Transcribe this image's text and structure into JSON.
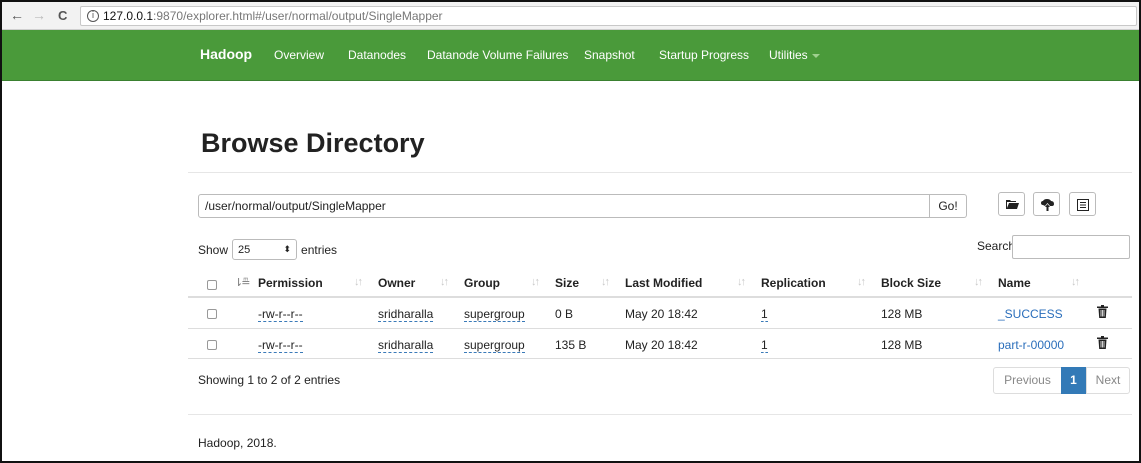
{
  "browser": {
    "host": "127.0.0.1",
    "url_rest": ":9870/explorer.html#/user/normal/output/SingleMapper",
    "back_icon": "←",
    "forward_icon": "→",
    "reload_icon": "C",
    "info_icon": "i"
  },
  "navbar": {
    "brand": "Hadoop",
    "items": [
      "Overview",
      "Datanodes",
      "Datanode Volume Failures",
      "Snapshot",
      "Startup Progress",
      "Utilities"
    ],
    "color": "#4a9a3a"
  },
  "page": {
    "title": "Browse Directory",
    "directory_value": "/user/normal/output/SingleMapper",
    "go_label": "Go!",
    "show_label": "Show",
    "entries_value": "25",
    "entries_label": "entries",
    "search_label": "Search:",
    "showing_text": "Showing 1 to 2 of 2 entries",
    "prev_label": "Previous",
    "page_number": "1",
    "next_label": "Next",
    "footer": "Hadoop, 2018."
  },
  "table": {
    "headers": [
      "Permission",
      "Owner",
      "Group",
      "Size",
      "Last Modified",
      "Replication",
      "Block Size",
      "Name"
    ],
    "rows": [
      [
        "-rw-r--r--",
        "sridharalla",
        "supergroup",
        "0 B",
        "May 20 18:42",
        "1",
        "128 MB",
        "_SUCCESS"
      ],
      [
        "-rw-r--r--",
        "sridharalla",
        "supergroup",
        "135 B",
        "May 20 18:42",
        "1",
        "128 MB",
        "part-r-00000"
      ]
    ]
  },
  "icons": [
    "folder-icon",
    "upload-icon",
    "list-icon",
    "trash-icon",
    "sort-icon",
    "sort-asc-icon"
  ]
}
